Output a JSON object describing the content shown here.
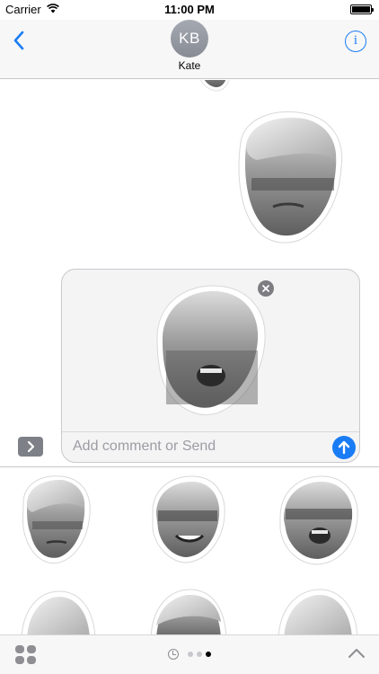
{
  "status_bar": {
    "carrier": "Carrier",
    "time": "11:00 PM"
  },
  "header": {
    "avatar_initials": "KB",
    "contact_name": "Kate",
    "back_icon": "chevron-left-icon",
    "info_icon": "info-icon",
    "info_glyph": "i"
  },
  "conversation": {
    "messages": [
      {
        "type": "sticker",
        "icon": "face-sticker",
        "direction": "outgoing",
        "state": "cut off at top"
      },
      {
        "type": "sticker",
        "icon": "face-sticker",
        "direction": "outgoing"
      }
    ]
  },
  "compose": {
    "placeholder": "Add comment or Send",
    "attached_sticker_icon": "face-sticker",
    "remove_icon": "close-icon",
    "send_icon": "arrow-up-icon",
    "expand_icon": "chevron-right-icon"
  },
  "sticker_drawer": {
    "stickers": [
      {
        "icon": "face-sticker"
      },
      {
        "icon": "face-sticker"
      },
      {
        "icon": "face-sticker"
      },
      {
        "icon": "face-sticker"
      },
      {
        "icon": "face-sticker"
      },
      {
        "icon": "face-sticker"
      }
    ]
  },
  "bottom_bar": {
    "app_drawer_icon": "app-grid-icon",
    "recents_icon": "clock-icon",
    "page_count": 3,
    "active_page": 3,
    "collapse_icon": "chevron-up-icon"
  },
  "colors": {
    "accent": "#1a7cf5",
    "header_bg": "#f7f7f7",
    "avatar_bg": "#8f939c",
    "compose_bg": "#f4f4f5",
    "separator": "#c8c8cc"
  }
}
